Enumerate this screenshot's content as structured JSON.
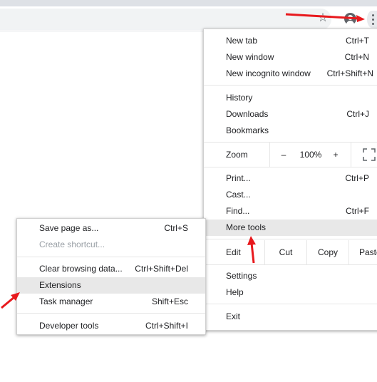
{
  "toolbar": {
    "bookmark_icon": "star-outline-icon",
    "profile_icon": "account-circle-icon",
    "menu_icon": "more-vertical-icon"
  },
  "main_menu": {
    "new_tab": {
      "label": "New tab",
      "shortcut": "Ctrl+T"
    },
    "new_window": {
      "label": "New window",
      "shortcut": "Ctrl+N"
    },
    "new_incognito": {
      "label": "New incognito window",
      "shortcut": "Ctrl+Shift+N"
    },
    "history": {
      "label": "History"
    },
    "downloads": {
      "label": "Downloads",
      "shortcut": "Ctrl+J"
    },
    "bookmarks": {
      "label": "Bookmarks"
    },
    "zoom": {
      "label": "Zoom",
      "minus": "–",
      "value": "100%",
      "plus": "+",
      "fullscreen_icon": "fullscreen-icon"
    },
    "print": {
      "label": "Print...",
      "shortcut": "Ctrl+P"
    },
    "cast": {
      "label": "Cast..."
    },
    "find": {
      "label": "Find...",
      "shortcut": "Ctrl+F"
    },
    "more_tools": {
      "label": "More tools"
    },
    "edit": {
      "label": "Edit",
      "cut": "Cut",
      "copy": "Copy",
      "paste": "Paste"
    },
    "settings": {
      "label": "Settings"
    },
    "help": {
      "label": "Help"
    },
    "exit": {
      "label": "Exit"
    }
  },
  "sub_menu": {
    "save_page": {
      "label": "Save page as...",
      "shortcut": "Ctrl+S"
    },
    "create_shortcut": {
      "label": "Create shortcut..."
    },
    "clear_browsing": {
      "label": "Clear browsing data...",
      "shortcut": "Ctrl+Shift+Del"
    },
    "extensions": {
      "label": "Extensions"
    },
    "task_manager": {
      "label": "Task manager",
      "shortcut": "Shift+Esc"
    },
    "developer_tools": {
      "label": "Developer tools",
      "shortcut": "Ctrl+Shift+I"
    }
  },
  "colors": {
    "annotation_arrow": "#e8191d",
    "highlight": "#e8e8e8"
  }
}
